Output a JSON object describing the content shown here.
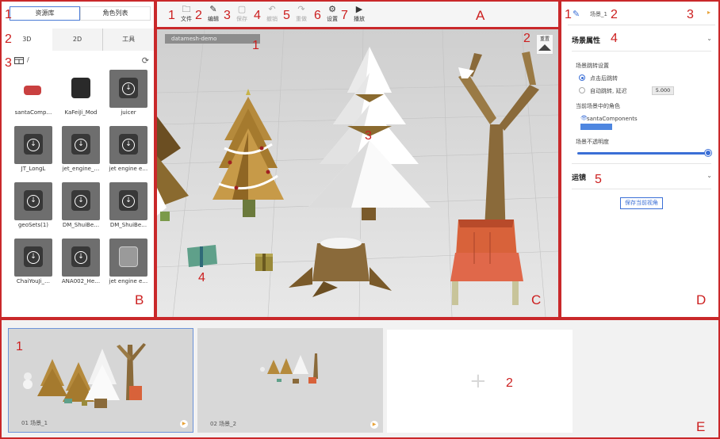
{
  "regions": {
    "a": "A",
    "b": "B",
    "c": "C",
    "d": "D",
    "e": "E"
  },
  "left_panel": {
    "marker_tabs": "1",
    "marker_subtabs": "2",
    "marker_path": "3",
    "tabs": [
      "资源库",
      "角色列表"
    ],
    "subtabs": [
      "3D",
      "2D",
      "工具"
    ],
    "path": "/",
    "assets": [
      {
        "label": "santaComp…",
        "style": "light",
        "icon": "santa-components-icon"
      },
      {
        "label": "KaFeiJi_Mod",
        "style": "light",
        "icon": "coffee-machine-icon"
      },
      {
        "label": "juicer",
        "style": "dark",
        "icon": "download-icon"
      },
      {
        "label": "JT_LongL",
        "style": "dark",
        "icon": "download-icon"
      },
      {
        "label": "jet_engine_…",
        "style": "dark",
        "icon": "download-icon"
      },
      {
        "label": "jet engine e…",
        "style": "dark",
        "icon": "download-icon"
      },
      {
        "label": "geoSets(1)",
        "style": "dark",
        "icon": "download-icon"
      },
      {
        "label": "DM_ShuiBe…",
        "style": "dark",
        "icon": "download-icon"
      },
      {
        "label": "DM_ShuiBe…",
        "style": "dark",
        "icon": "download-icon"
      },
      {
        "label": "ChaiYouJi_…",
        "style": "dark",
        "icon": "download-icon"
      },
      {
        "label": "ANA002_He…",
        "style": "dark",
        "icon": "download-icon"
      },
      {
        "label": "jet engine e…",
        "style": "dark",
        "icon": "cube-icon"
      }
    ]
  },
  "toolbar": {
    "items": [
      {
        "num": "1",
        "label": "文件",
        "icon": "folder-icon",
        "enabled": true
      },
      {
        "num": "2",
        "label": "编辑",
        "icon": "edit-icon",
        "enabled": true
      },
      {
        "num": "3",
        "label": "保存",
        "icon": "save-icon",
        "enabled": false
      },
      {
        "num": "4",
        "label": "撤销",
        "icon": "undo-icon",
        "enabled": false
      },
      {
        "num": "5",
        "label": "重做",
        "icon": "redo-icon",
        "enabled": false
      },
      {
        "num": "6",
        "label": "设置",
        "icon": "settings-icon",
        "enabled": true
      },
      {
        "num": "7",
        "label": "播放",
        "icon": "play-icon",
        "enabled": true
      }
    ]
  },
  "viewport": {
    "scene_tag": "datamesh-demo",
    "reset_label": "重置",
    "marker_tag": "1",
    "marker_reset": "2",
    "marker_objects": "3",
    "marker_gifts": "4"
  },
  "right_panel": {
    "marker_edit": "1",
    "marker_name": "2",
    "marker_play": "3",
    "marker_props": "4",
    "marker_camera": "5",
    "scene_name": "场景_1",
    "section_props": "场景属性",
    "jump_settings": "场景跳转设置",
    "jump_options": [
      "点击后跳转",
      "自动跳转, 延迟"
    ],
    "jump_selected": 0,
    "delay_value": "5.000",
    "roles_label": "当前场景中的角色",
    "role_name": "santaComponents",
    "opacity_label": "场景不透明度",
    "opacity": 1.0,
    "section_camera": "运镜",
    "save_view": "保存当前视角",
    "accent": "#3b6fd6"
  },
  "bottom": {
    "marker_first": "1",
    "marker_add": "2",
    "scenes": [
      {
        "caption": "01  场景_1",
        "selected": true
      },
      {
        "caption": "02  场景_2",
        "selected": false
      }
    ]
  },
  "annotation_color": "#cc1f1f"
}
